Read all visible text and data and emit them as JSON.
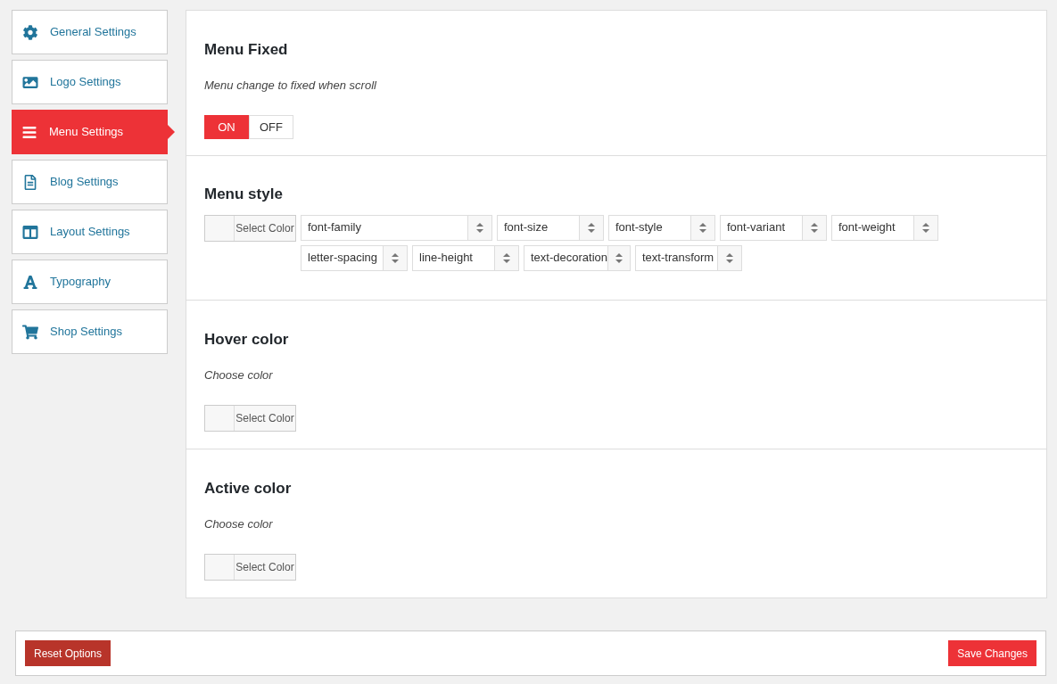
{
  "sidebar": {
    "items": [
      {
        "label": "General Settings",
        "selected": false
      },
      {
        "label": "Logo Settings",
        "selected": false
      },
      {
        "label": "Menu Settings",
        "selected": true
      },
      {
        "label": "Blog Settings",
        "selected": false
      },
      {
        "label": "Layout Settings",
        "selected": false
      },
      {
        "label": "Typography",
        "selected": false
      },
      {
        "label": "Shop Settings",
        "selected": false
      }
    ]
  },
  "sections": [
    {
      "kind": "toggle",
      "title": "Menu Fixed",
      "description": "Menu change to fixed when scroll",
      "options": [
        {
          "label": "ON",
          "selected": true
        },
        {
          "label": "OFF",
          "selected": false
        }
      ]
    },
    {
      "kind": "typography",
      "title": "Menu style",
      "color_button": "Select Color",
      "selects": [
        "font-family",
        "font-size",
        "font-style",
        "font-variant",
        "font-weight",
        "letter-spacing",
        "line-height",
        "text-decoration",
        "text-transform"
      ]
    },
    {
      "kind": "color",
      "title": "Hover color",
      "description": "Choose color",
      "color_button": "Select Color"
    },
    {
      "kind": "color",
      "title": "Active color",
      "description": "Choose color",
      "color_button": "Select Color"
    }
  ],
  "footer": {
    "reset": "Reset Options",
    "save": "Save Changes"
  }
}
